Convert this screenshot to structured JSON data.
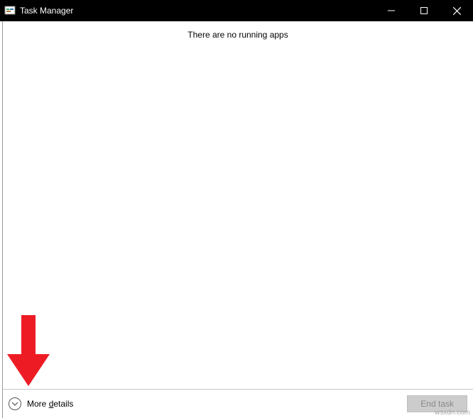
{
  "window": {
    "title": "Task Manager"
  },
  "main": {
    "empty_message": "There are no running apps"
  },
  "footer": {
    "more_details_prefix": "More ",
    "more_details_underline": "d",
    "more_details_suffix": "etails",
    "end_task_label": "End task"
  },
  "watermark": "wsxdn.com",
  "colors": {
    "titlebar_bg": "#000000",
    "arrow": "#ED1C24",
    "disabled_btn_bg": "#CCCCCC",
    "disabled_btn_fg": "#888888"
  }
}
